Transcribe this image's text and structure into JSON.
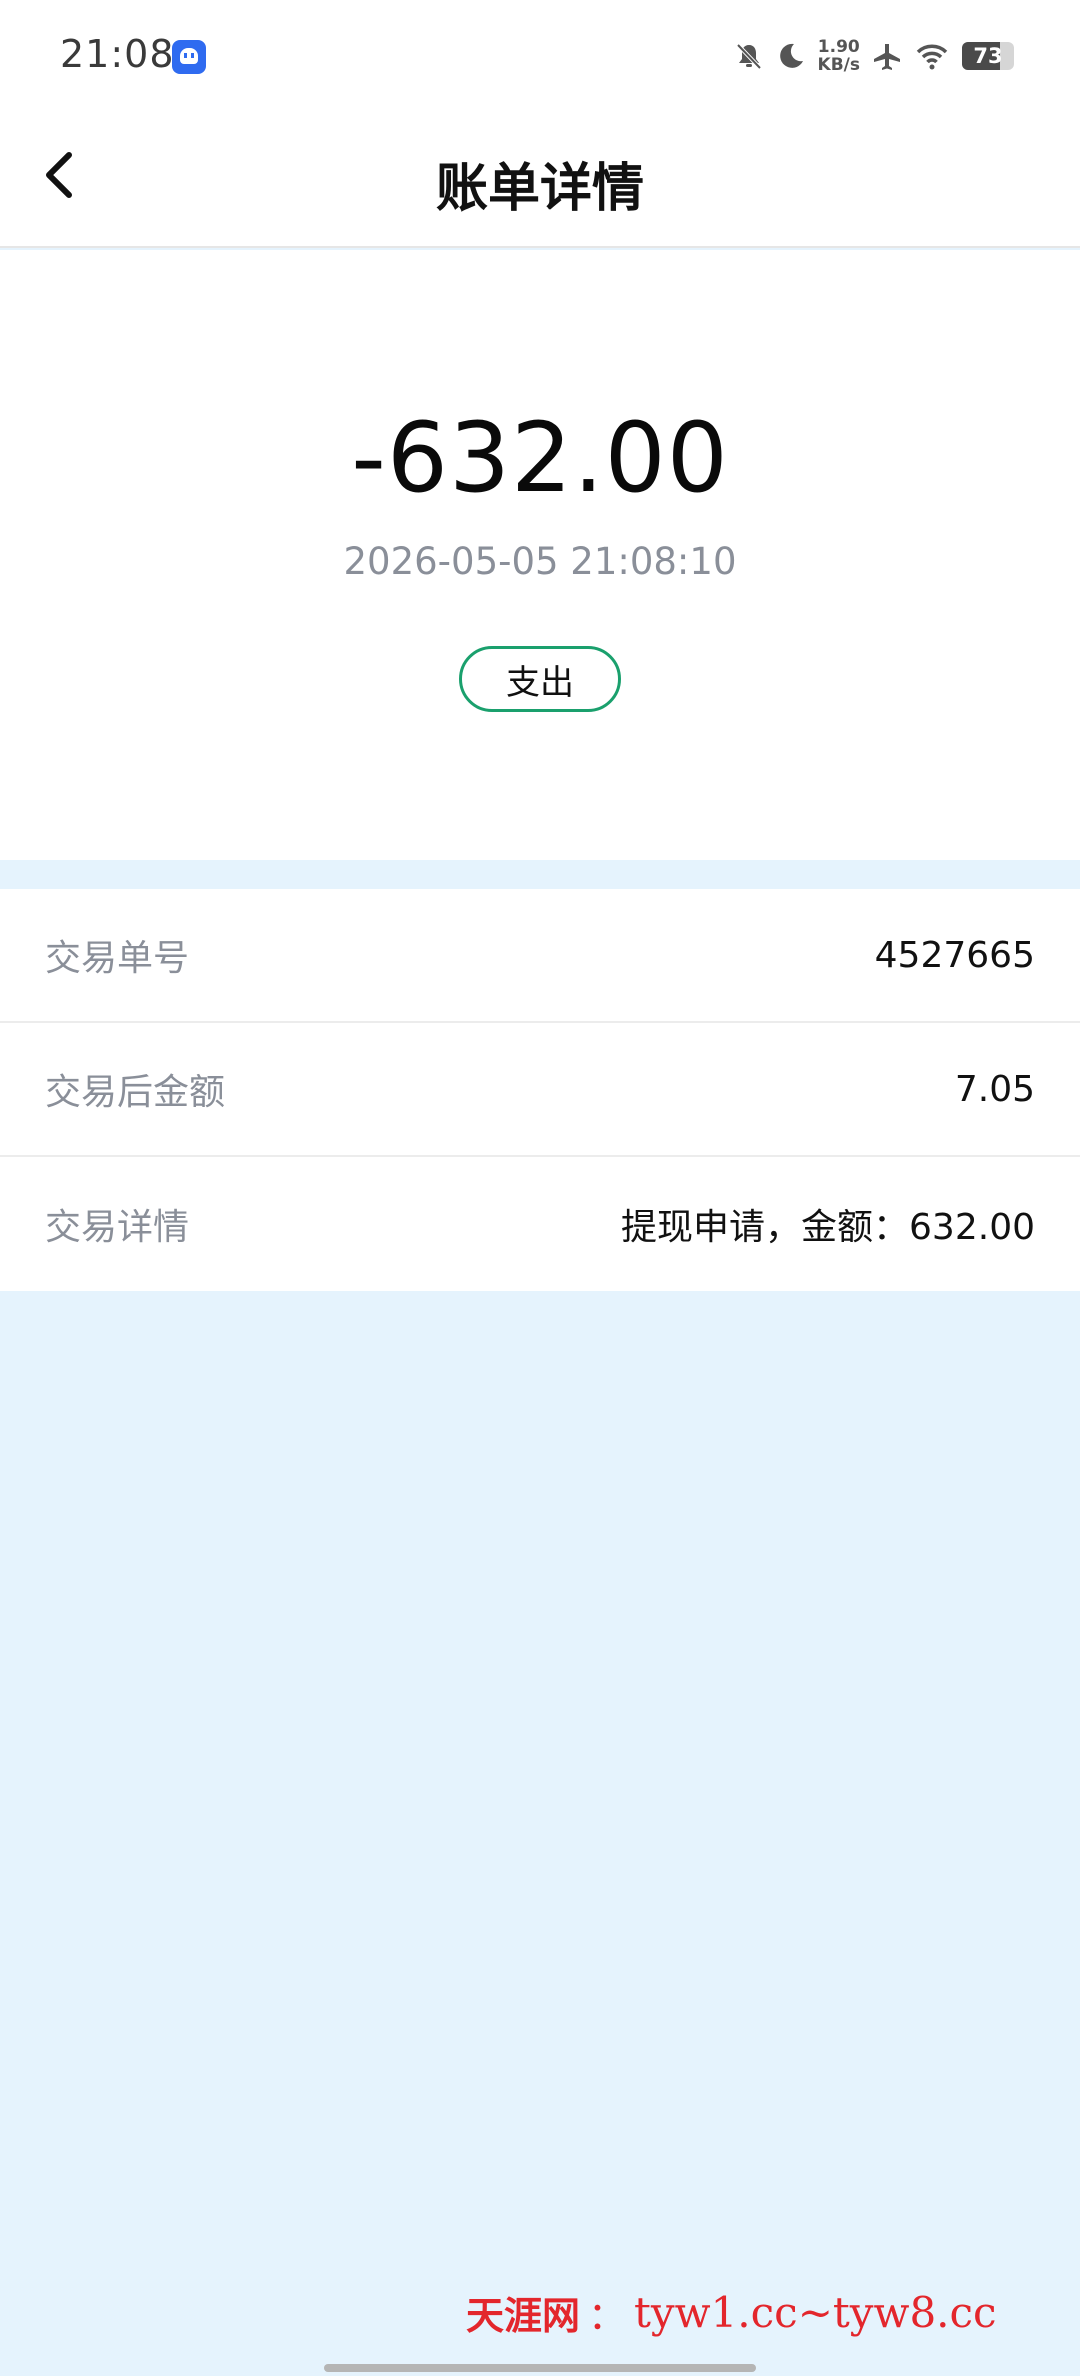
{
  "status_bar": {
    "time": "21:08",
    "notification_icon": "chat-app-icon",
    "net_speed_value": "1.90",
    "net_speed_unit": "KB/s",
    "battery_level": "73",
    "icons": [
      "bell-muted-icon",
      "moon-icon",
      "airplane-icon",
      "wifi-icon",
      "battery-icon"
    ]
  },
  "nav": {
    "title": "账单详情",
    "back_icon": "chevron-left-icon"
  },
  "transaction": {
    "amount": "-632.00",
    "datetime": "2026-05-05 21:08:10",
    "type": "支出",
    "type_color": "#1aa06d"
  },
  "details": [
    {
      "label": "交易单号",
      "value": "4527665"
    },
    {
      "label": "交易后金额",
      "value": "7.05"
    },
    {
      "label": "交易详情",
      "value": "提现申请，金额：632.00"
    }
  ],
  "watermark": {
    "brand": "天涯网",
    "separator": "：",
    "url": "tyw1.cc~tyw8.cc"
  },
  "colors": {
    "background": "#e5f3fd",
    "card": "#ffffff",
    "label_text": "#8a8f99",
    "watermark": "#e3262c"
  }
}
